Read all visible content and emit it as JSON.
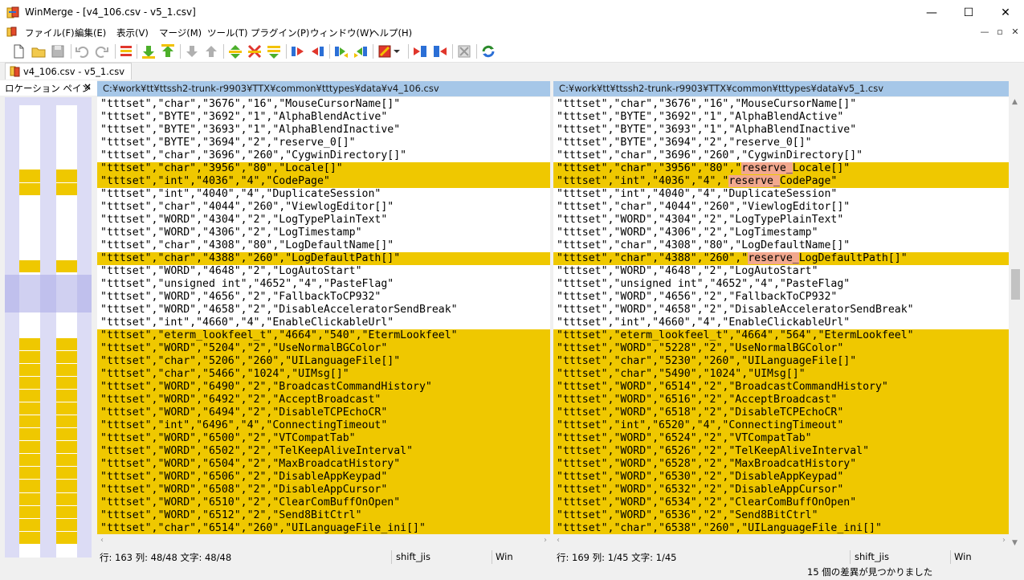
{
  "window": {
    "title": "WinMerge - [v4_106.csv - v5_1.csv]",
    "minimize_glyph": "—",
    "maximize_glyph": "☐",
    "close_glyph": "✕"
  },
  "menu": [
    "ファイル(F)",
    "編集(E)",
    "表示(V)",
    "マージ(M)",
    "ツール(T)",
    "プラグイン(P)",
    "ウィンドウ(W)",
    "ヘルプ(H)"
  ],
  "mdi_controls": [
    "—",
    "▫",
    "✕"
  ],
  "toolbar": {
    "buttons": [
      "new-icon",
      "open-icon",
      "save-icon",
      "undo-icon",
      "redo-icon",
      "diff-list-icon",
      "next-diff-icon",
      "prev-diff-icon",
      "first-diff-icon",
      "last-diff-icon",
      "current-diff-icon",
      "next-conflict-icon",
      "prev-conflict-icon",
      "copy-right-icon",
      "copy-left-icon",
      "copy-right-advance-icon",
      "copy-left-advance-icon",
      "options-icon",
      "dropdown-icon",
      "open-left-icon",
      "open-right-icon",
      "collapse-icon",
      "refresh-icon"
    ]
  },
  "tab": {
    "label": "v4_106.csv - v5_1.csv"
  },
  "location_pane": {
    "title": "ロケーション ペイン",
    "close": "×"
  },
  "left": {
    "path": "C:¥work¥tt¥ttssh2-trunk-r9903¥TTX¥common¥tttypes¥data¥v4_106.csv",
    "status": {
      "position": "行: 163  列: 48/48  文字: 48/48",
      "encoding": "shift_jis",
      "eol": "Win"
    },
    "lines": [
      {
        "text": "\"tttset\",\"char\",\"3676\",\"16\",\"MouseCursorName[]\"",
        "diff": false
      },
      {
        "text": "\"tttset\",\"BYTE\",\"3692\",\"1\",\"AlphaBlendActive\"",
        "diff": false
      },
      {
        "text": "\"tttset\",\"BYTE\",\"3693\",\"1\",\"AlphaBlendInactive\"",
        "diff": false
      },
      {
        "text": "\"tttset\",\"BYTE\",\"3694\",\"2\",\"reserve_0[]\"",
        "diff": false
      },
      {
        "text": "\"tttset\",\"char\",\"3696\",\"260\",\"CygwinDirectory[]\"",
        "diff": false
      },
      {
        "text": "\"tttset\",\"char\",\"3956\",\"80\",\"Locale[]\"",
        "diff": true
      },
      {
        "text": "\"tttset\",\"int\",\"4036\",\"4\",\"CodePage\"",
        "diff": true
      },
      {
        "text": "\"tttset\",\"int\",\"4040\",\"4\",\"DuplicateSession\"",
        "diff": false
      },
      {
        "text": "\"tttset\",\"char\",\"4044\",\"260\",\"ViewlogEditor[]\"",
        "diff": false
      },
      {
        "text": "\"tttset\",\"WORD\",\"4304\",\"2\",\"LogTypePlainText\"",
        "diff": false
      },
      {
        "text": "\"tttset\",\"WORD\",\"4306\",\"2\",\"LogTimestamp\"",
        "diff": false
      },
      {
        "text": "\"tttset\",\"char\",\"4308\",\"80\",\"LogDefaultName[]\"",
        "diff": false
      },
      {
        "text": "\"tttset\",\"char\",\"4388\",\"260\",\"LogDefaultPath[]\"",
        "diff": true
      },
      {
        "text": "\"tttset\",\"WORD\",\"4648\",\"2\",\"LogAutoStart\"",
        "diff": false
      },
      {
        "text": "\"tttset\",\"unsigned int\",\"4652\",\"4\",\"PasteFlag\"",
        "diff": false
      },
      {
        "text": "\"tttset\",\"WORD\",\"4656\",\"2\",\"FallbackToCP932\"",
        "diff": false
      },
      {
        "text": "\"tttset\",\"WORD\",\"4658\",\"2\",\"DisableAcceleratorSendBreak\"",
        "diff": false
      },
      {
        "text": "\"tttset\",\"int\",\"4660\",\"4\",\"EnableClickableUrl\"",
        "diff": false
      },
      {
        "text": "\"tttset\",\"eterm_lookfeel_t\",\"4664\",\"540\",\"EtermLookfeel\"",
        "diff": true
      },
      {
        "text": "\"tttset\",\"WORD\",\"5204\",\"2\",\"UseNormalBGColor\"",
        "diff": true
      },
      {
        "text": "\"tttset\",\"char\",\"5206\",\"260\",\"UILanguageFile[]\"",
        "diff": true
      },
      {
        "text": "\"tttset\",\"char\",\"5466\",\"1024\",\"UIMsg[]\"",
        "diff": true
      },
      {
        "text": "\"tttset\",\"WORD\",\"6490\",\"2\",\"BroadcastCommandHistory\"",
        "diff": true
      },
      {
        "text": "\"tttset\",\"WORD\",\"6492\",\"2\",\"AcceptBroadcast\"",
        "diff": true
      },
      {
        "text": "\"tttset\",\"WORD\",\"6494\",\"2\",\"DisableTCPEchoCR\"",
        "diff": true
      },
      {
        "text": "\"tttset\",\"int\",\"6496\",\"4\",\"ConnectingTimeout\"",
        "diff": true
      },
      {
        "text": "\"tttset\",\"WORD\",\"6500\",\"2\",\"VTCompatTab\"",
        "diff": true
      },
      {
        "text": "\"tttset\",\"WORD\",\"6502\",\"2\",\"TelKeepAliveInterval\"",
        "diff": true
      },
      {
        "text": "\"tttset\",\"WORD\",\"6504\",\"2\",\"MaxBroadcatHistory\"",
        "diff": true
      },
      {
        "text": "\"tttset\",\"WORD\",\"6506\",\"2\",\"DisableAppKeypad\"",
        "diff": true
      },
      {
        "text": "\"tttset\",\"WORD\",\"6508\",\"2\",\"DisableAppCursor\"",
        "diff": true
      },
      {
        "text": "\"tttset\",\"WORD\",\"6510\",\"2\",\"ClearComBuffOnOpen\"",
        "diff": true
      },
      {
        "text": "\"tttset\",\"WORD\",\"6512\",\"2\",\"Send8BitCtrl\"",
        "diff": true
      },
      {
        "text": "\"tttset\",\"char\",\"6514\",\"260\",\"UILanguageFile_ini[]\"",
        "diff": true
      }
    ]
  },
  "right": {
    "path": "C:¥work¥tt¥ttssh2-trunk-r9903¥TTX¥common¥tttypes¥data¥v5_1.csv",
    "status": {
      "position": "行: 169  列: 1/45  文字: 1/45",
      "encoding": "shift_jis",
      "eol": "Win"
    },
    "lines": [
      {
        "text": "\"tttset\",\"char\",\"3676\",\"16\",\"MouseCursorName[]\"",
        "diff": false
      },
      {
        "text": "\"tttset\",\"BYTE\",\"3692\",\"1\",\"AlphaBlendActive\"",
        "diff": false
      },
      {
        "text": "\"tttset\",\"BYTE\",\"3693\",\"1\",\"AlphaBlendInactive\"",
        "diff": false
      },
      {
        "text": "\"tttset\",\"BYTE\",\"3694\",\"2\",\"reserve_0[]\"",
        "diff": false
      },
      {
        "text": "\"tttset\",\"char\",\"3696\",\"260\",\"CygwinDirectory[]\"",
        "diff": false
      },
      {
        "pre": "\"tttset\",\"char\",\"3956\",\"80\",\"",
        "hl": "reserve_",
        "post": "Locale[]\"",
        "diff": true
      },
      {
        "pre": "\"tttset\",\"int\",\"4036\",\"4\",\"",
        "hl": "reserve_",
        "post": "CodePage\"",
        "diff": true
      },
      {
        "text": "\"tttset\",\"int\",\"4040\",\"4\",\"DuplicateSession\"",
        "diff": false
      },
      {
        "text": "\"tttset\",\"char\",\"4044\",\"260\",\"ViewlogEditor[]\"",
        "diff": false
      },
      {
        "text": "\"tttset\",\"WORD\",\"4304\",\"2\",\"LogTypePlainText\"",
        "diff": false
      },
      {
        "text": "\"tttset\",\"WORD\",\"4306\",\"2\",\"LogTimestamp\"",
        "diff": false
      },
      {
        "text": "\"tttset\",\"char\",\"4308\",\"80\",\"LogDefaultName[]\"",
        "diff": false
      },
      {
        "pre": "\"tttset\",\"char\",\"4388\",\"260\",\"",
        "hl": "reserve_",
        "post": "LogDefaultPath[]\"",
        "diff": true
      },
      {
        "text": "\"tttset\",\"WORD\",\"4648\",\"2\",\"LogAutoStart\"",
        "diff": false
      },
      {
        "text": "\"tttset\",\"unsigned int\",\"4652\",\"4\",\"PasteFlag\"",
        "diff": false
      },
      {
        "text": "\"tttset\",\"WORD\",\"4656\",\"2\",\"FallbackToCP932\"",
        "diff": false
      },
      {
        "text": "\"tttset\",\"WORD\",\"4658\",\"2\",\"DisableAcceleratorSendBreak\"",
        "diff": false
      },
      {
        "text": "\"tttset\",\"int\",\"4660\",\"4\",\"EnableClickableUrl\"",
        "diff": false
      },
      {
        "text": "\"tttset\",\"eterm_lookfeel_t\",\"4664\",\"564\",\"EtermLookfeel\"",
        "diff": true
      },
      {
        "text": "\"tttset\",\"WORD\",\"5228\",\"2\",\"UseNormalBGColor\"",
        "diff": true
      },
      {
        "text": "\"tttset\",\"char\",\"5230\",\"260\",\"UILanguageFile[]\"",
        "diff": true
      },
      {
        "text": "\"tttset\",\"char\",\"5490\",\"1024\",\"UIMsg[]\"",
        "diff": true
      },
      {
        "text": "\"tttset\",\"WORD\",\"6514\",\"2\",\"BroadcastCommandHistory\"",
        "diff": true
      },
      {
        "text": "\"tttset\",\"WORD\",\"6516\",\"2\",\"AcceptBroadcast\"",
        "diff": true
      },
      {
        "text": "\"tttset\",\"WORD\",\"6518\",\"2\",\"DisableTCPEchoCR\"",
        "diff": true
      },
      {
        "text": "\"tttset\",\"int\",\"6520\",\"4\",\"ConnectingTimeout\"",
        "diff": true
      },
      {
        "text": "\"tttset\",\"WORD\",\"6524\",\"2\",\"VTCompatTab\"",
        "diff": true
      },
      {
        "text": "\"tttset\",\"WORD\",\"6526\",\"2\",\"TelKeepAliveInterval\"",
        "diff": true
      },
      {
        "text": "\"tttset\",\"WORD\",\"6528\",\"2\",\"MaxBroadcatHistory\"",
        "diff": true
      },
      {
        "text": "\"tttset\",\"WORD\",\"6530\",\"2\",\"DisableAppKeypad\"",
        "diff": true
      },
      {
        "text": "\"tttset\",\"WORD\",\"6532\",\"2\",\"DisableAppCursor\"",
        "diff": true
      },
      {
        "text": "\"tttset\",\"WORD\",\"6534\",\"2\",\"ClearComBuffOnOpen\"",
        "diff": true
      },
      {
        "text": "\"tttset\",\"WORD\",\"6536\",\"2\",\"Send8BitCtrl\"",
        "diff": true
      },
      {
        "text": "\"tttset\",\"char\",\"6538\",\"260\",\"UILanguageFile_ini[]\"",
        "diff": true
      }
    ]
  },
  "status_bar": {
    "message": "15 個の差異が見つかりました"
  },
  "colors": {
    "diff": "#efc800",
    "word_diff": "#f2a88e",
    "header": "#a6c7e8",
    "location_bg": "#dcdcf5"
  }
}
